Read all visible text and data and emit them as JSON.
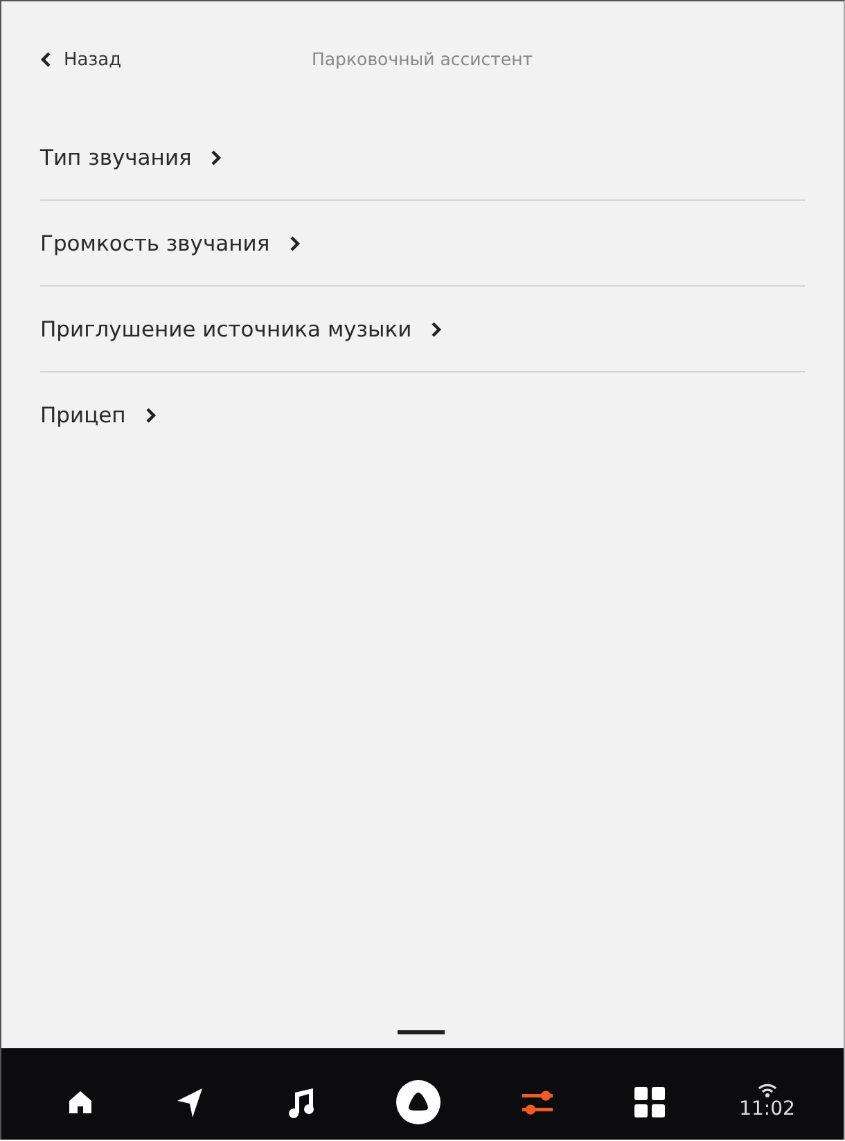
{
  "header": {
    "back": "Назад",
    "title": "Парковочный ассистент"
  },
  "items": [
    {
      "label": "Тип звучания"
    },
    {
      "label": "Громкость звучания"
    },
    {
      "label": "Приглушение источника музыки"
    },
    {
      "label": "Прицеп"
    }
  ],
  "dock": [
    {
      "kind": "home",
      "selected": false
    },
    {
      "kind": "navigate",
      "selected": false
    },
    {
      "kind": "music",
      "selected": false
    },
    {
      "kind": "assistant",
      "selected": false
    },
    {
      "kind": "settings",
      "selected": true
    },
    {
      "kind": "apps",
      "selected": false
    }
  ],
  "status": {
    "time": "11:02"
  }
}
